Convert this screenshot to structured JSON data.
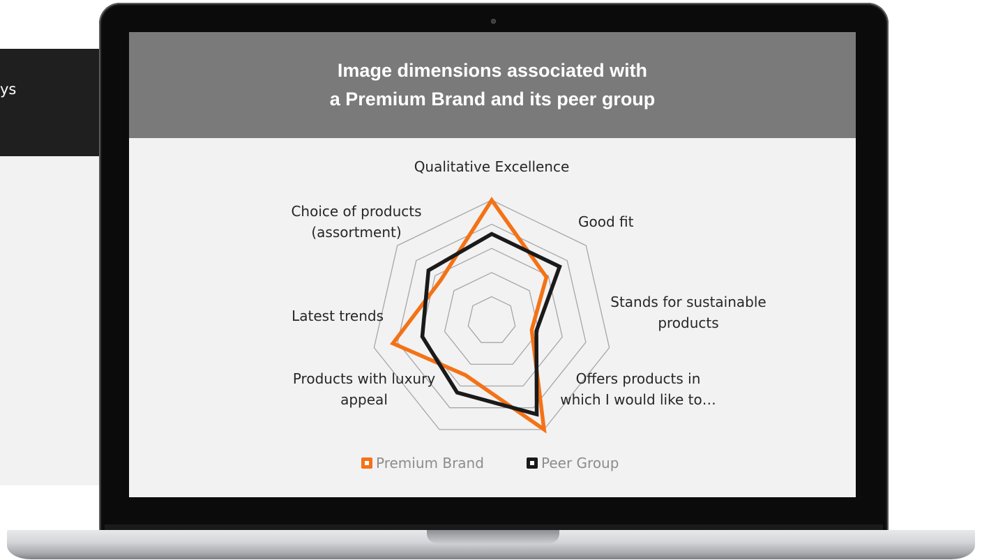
{
  "background_card": {
    "text": "ys"
  },
  "screen": {
    "title_line1": "Image dimensions associated with",
    "title_line2": "a Premium Brand and its peer group",
    "header_color": "#7a7a7a"
  },
  "chart_data": {
    "type": "radar",
    "title": "Image dimensions associated with a Premium Brand and its peer group",
    "axes": [
      {
        "label_lines": [
          "Qualitative Excellence"
        ]
      },
      {
        "label_lines": [
          "Good fit"
        ]
      },
      {
        "label_lines": [
          "Stands for sustainable",
          "products"
        ]
      },
      {
        "label_lines": [
          "Offers products in",
          "which I would like to…"
        ]
      },
      {
        "label_lines": [
          "Products with luxury",
          "appeal"
        ]
      },
      {
        "label_lines": [
          "Latest trends"
        ]
      },
      {
        "label_lines": [
          "Choice of products",
          "(assortment)"
        ]
      }
    ],
    "rings": 5,
    "series": [
      {
        "name": "Premium Brand",
        "color": "#f47216",
        "values": [
          1.0,
          0.58,
          0.34,
          1.0,
          0.5,
          0.84,
          0.54
        ]
      },
      {
        "name": "Peer Group",
        "color": "#1a1a1a",
        "values": [
          0.72,
          0.72,
          0.38,
          0.86,
          0.66,
          0.59,
          0.67
        ]
      }
    ],
    "legend_position": "bottom",
    "grid": true
  }
}
